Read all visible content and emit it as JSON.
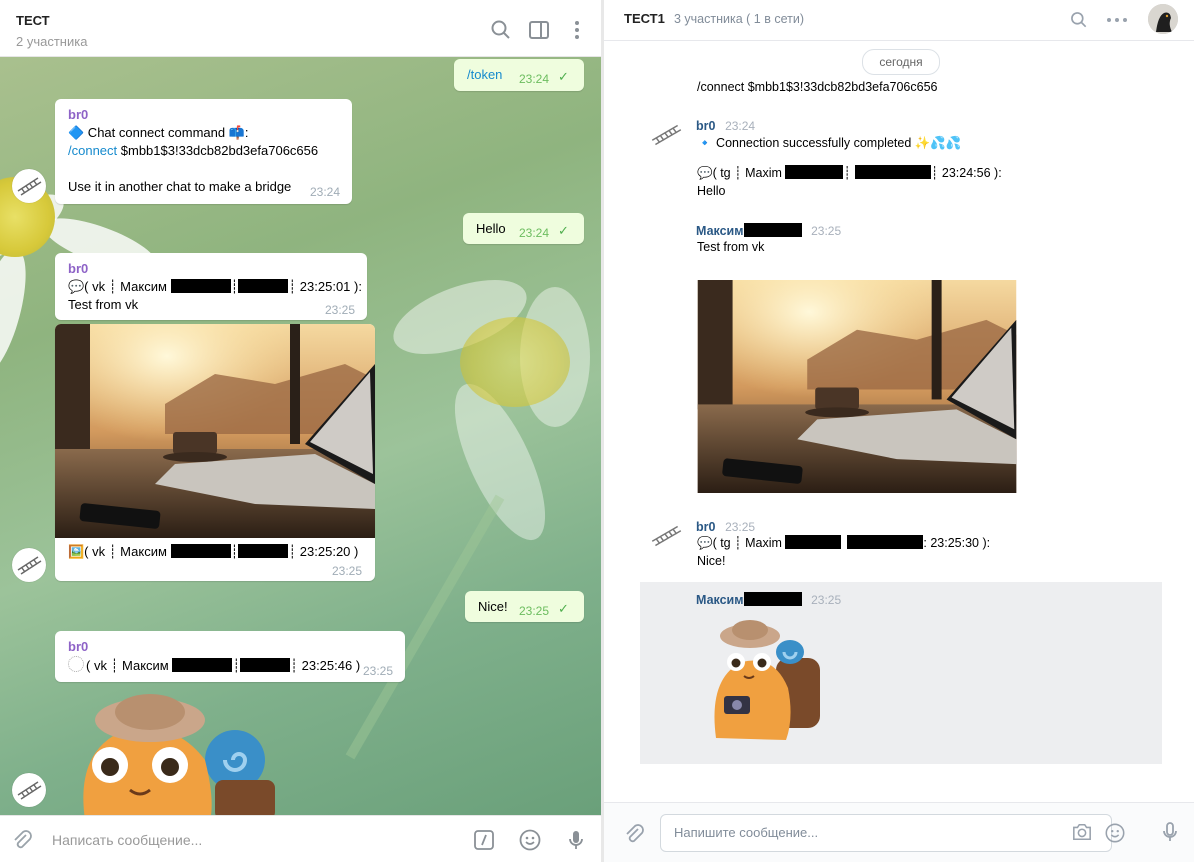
{
  "telegram": {
    "chat_title": "ТЕСТ",
    "chat_subtitle": "2 участника",
    "input_placeholder": "Написать сообщение...",
    "messages": {
      "token": {
        "text": "/token",
        "time": "23:24"
      },
      "bot1": {
        "sender": "br0",
        "line1_emoji": "🔷",
        "line1": " Chat connect command 📫:",
        "cmd": "/connect",
        "cmd_arg": " $mbb1$3!33dcb82bd3efa706c656",
        "line3": "Use it in another chat to make a bridge",
        "time": "23:24"
      },
      "hello": {
        "text": "Hello",
        "time": "23:24"
      },
      "bot2": {
        "sender": "br0",
        "prefix": "💬( vk ┊ Максим ",
        "sep": "┊",
        "suffix": "┊ 23:25:01 ):",
        "text": "Test from vk",
        "time": "23:25"
      },
      "photo_msg": {
        "prefix": "🖼️( vk ┊ Максим ",
        "sep": "┊",
        "suffix": "┊ 23:25:20 )",
        "time": "23:25"
      },
      "nice": {
        "text": "Nice!",
        "time": "23:25"
      },
      "bot3": {
        "sender": "br0",
        "prefix": "( vk ┊ Максим ",
        "sep": "┊",
        "suffix": "┊ 23:25:46 )",
        "time": "23:25"
      }
    }
  },
  "vk": {
    "chat_title": "ТЕСТ1",
    "chat_subtitle": "3 участника ( 1 в сети)",
    "date_pill": "сегодня",
    "input_placeholder": "Напишите сообщение...",
    "messages": {
      "connect_cmd": "/connect $mbb1$3!33dcb82bd3efa706c656",
      "bot1": {
        "sender": "br0",
        "time": "23:24",
        "text": "🔹 Connection successfully completed ✨💦💦",
        "line2_prefix": "💬( tg ┊ Maxim ",
        "line2_sep": "┊",
        "line2_suffix": "┊ 23:24:56 ):",
        "line3": "Hello"
      },
      "user1": {
        "sender": "Максим",
        "time": "23:25",
        "text": "Test from vk"
      },
      "bot2": {
        "sender": "br0",
        "time": "23:25",
        "line1_prefix": "💬( tg ┊ Maxim ",
        "line1_sep": "",
        "line1_suffix": ": 23:25:30 ):",
        "line2": "Nice!"
      },
      "user2": {
        "sender": "Максим",
        "time": "23:25"
      }
    }
  }
}
